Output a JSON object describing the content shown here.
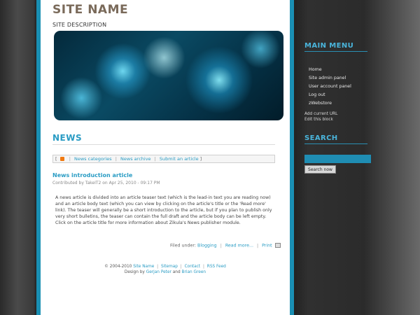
{
  "header": {
    "site_name": "SITE NAME",
    "site_description": "SITE DESCRIPTION"
  },
  "news": {
    "title": "NEWS",
    "nav": {
      "open_bracket": "[",
      "close_bracket": "]",
      "separator": "|",
      "categories": "News categories",
      "archive": "News archive",
      "submit": "Submit an article"
    }
  },
  "article": {
    "title": "News introduction article",
    "meta": "Contributed by TakeIT2 on Apr 25, 2010 - 09:17 PM",
    "body": "A news article is divided into an article teaser text (which is the lead-in text you are reading now) and an article body text (which you can view by clicking on the article's title or the 'Read more' link). The teaser will generally be a short introduction to the article, but if you plan to publish only very short bulletins, the teaser can contain the full draft and the article body can be left empty. Click on the article title for more information about Zikula's News publisher module.",
    "footer": {
      "filed_under": "Filed under:",
      "category": "Blogging",
      "read_more": "Read more...",
      "print": "Print",
      "separator": "|"
    }
  },
  "footer": {
    "copyright": "© 2004-2010",
    "site_link": "Site Name",
    "sitemap": "Sitemap",
    "contact": "Contact",
    "rss": "RSS Feed",
    "separator": "|",
    "design_by": "Design by",
    "designer1": "Gerjan Peter",
    "and": "and",
    "designer2": "Brian Green"
  },
  "sidebar": {
    "main_menu_title": "MAIN MENU",
    "menu_items": [
      {
        "label": "Home"
      },
      {
        "label": "Site admin panel"
      },
      {
        "label": "User account panel"
      },
      {
        "label": "Log out"
      },
      {
        "label": "zWebstore"
      }
    ],
    "add_current_url": "Add current URL",
    "edit_this_block": "Edit this block",
    "search_title": "SEARCH",
    "search_value": "",
    "search_button": "Search now"
  },
  "colors": {
    "accent": "#1a8fb3",
    "link": "#2a9cc4",
    "site_name": "#7a6a5a",
    "rss": "#f07a12"
  }
}
